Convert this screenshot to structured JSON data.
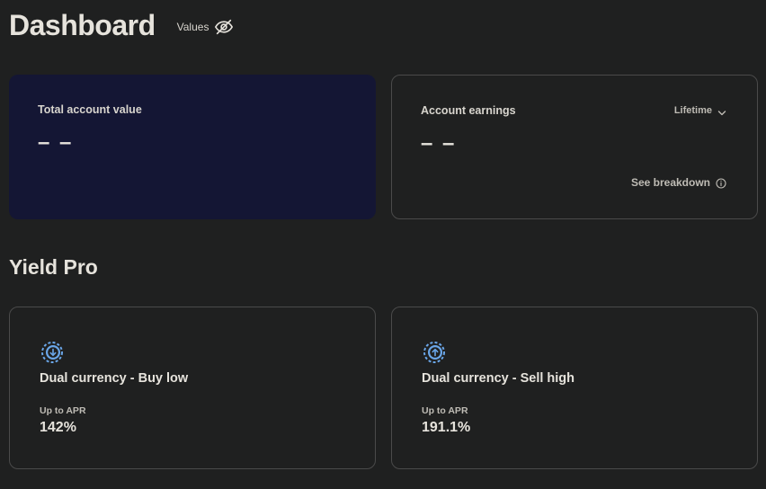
{
  "header": {
    "title": "Dashboard",
    "values_label": "Values"
  },
  "total_account": {
    "label": "Total account value",
    "value": "– –"
  },
  "earnings": {
    "label": "Account earnings",
    "value": "– –",
    "period": "Lifetime",
    "breakdown_label": "See breakdown"
  },
  "yield_pro": {
    "title": "Yield Pro",
    "products": [
      {
        "name": "Dual currency - Buy low",
        "apr_label": "Up to APR",
        "apr_value": "142%",
        "icon": "arrow-down-circle-icon"
      },
      {
        "name": "Dual currency - Sell high",
        "apr_label": "Up to APR",
        "apr_value": "191.1%",
        "icon": "arrow-up-circle-icon"
      }
    ]
  },
  "colors": {
    "background": "#1f2020",
    "total_card_bg": "#141634",
    "border": "#4a4a4a",
    "text": "#e6e3dc",
    "muted_text": "#bfbcb5",
    "icon_blue": "#6aa6e8"
  }
}
